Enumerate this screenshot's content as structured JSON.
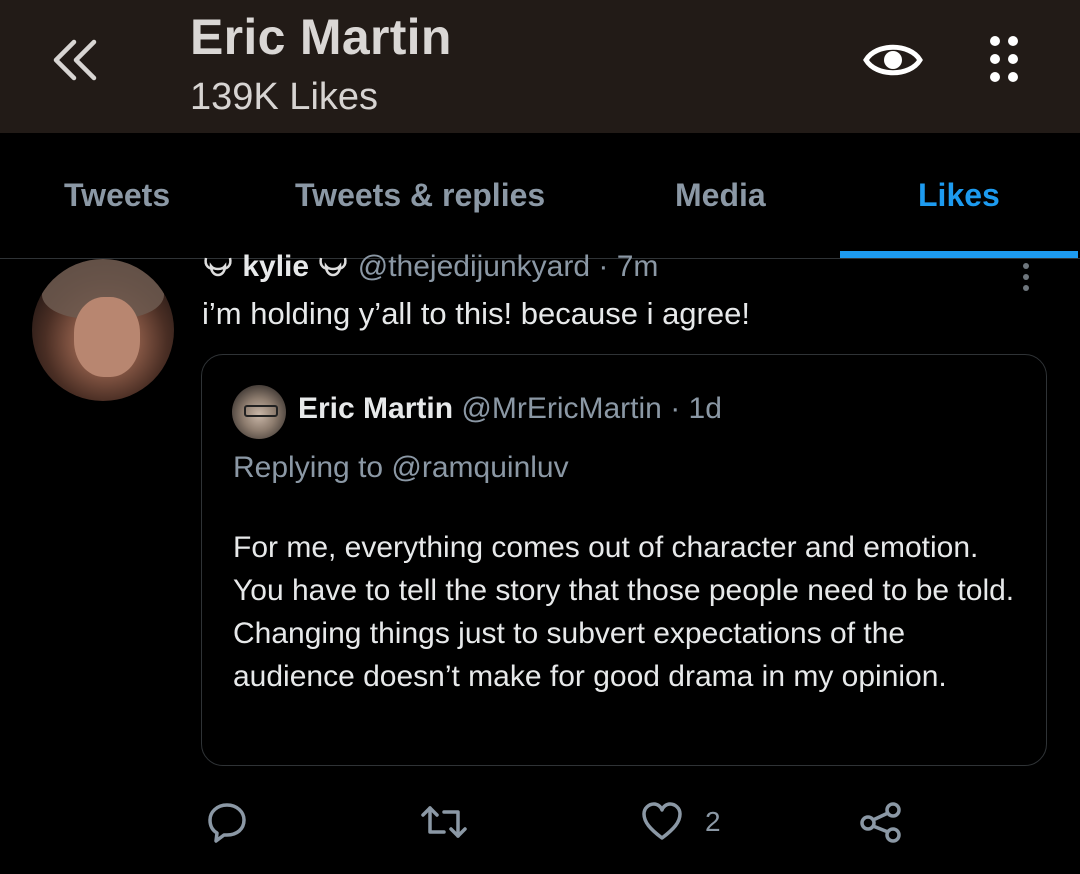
{
  "header": {
    "title": "Eric Martin",
    "subtitle": "139K Likes",
    "icons": {
      "back": "double-chevron-left-icon",
      "view": "eye-icon",
      "menu": "vertical-dots-grid-icon"
    }
  },
  "tabs": [
    {
      "label": "Tweets",
      "active": false
    },
    {
      "label": "Tweets & replies",
      "active": false
    },
    {
      "label": "Media",
      "active": false
    },
    {
      "label": "Likes",
      "active": true
    }
  ],
  "tweet": {
    "display_name": "kylie",
    "name_emoji": "horned-helmet-emoji",
    "handle": "@thejedijunkyard",
    "time": "· 7m",
    "text": "i’m holding y’all to this! because i agree!",
    "quoted": {
      "display_name": "Eric Martin",
      "handle": "@MrEricMartin",
      "time": "· 1d",
      "replying_to": "Replying to @ramquinluv",
      "text": "For me, everything comes out of character and emotion. You have to tell the story that those people need to be told. Changing things just to subvert expectations of the audience doesn’t make for good drama in my opinion."
    },
    "actions": {
      "reply_icon": "speech-bubble-icon",
      "retweet_icon": "retweet-icon",
      "like_icon": "heart-icon",
      "like_count": "2",
      "share_icon": "share-icon"
    }
  },
  "colors": {
    "header_bg": "#221b17",
    "accent": "#1d9bf0",
    "secondary_text": "#8b98a5",
    "primary_text": "#e7e9ea"
  }
}
